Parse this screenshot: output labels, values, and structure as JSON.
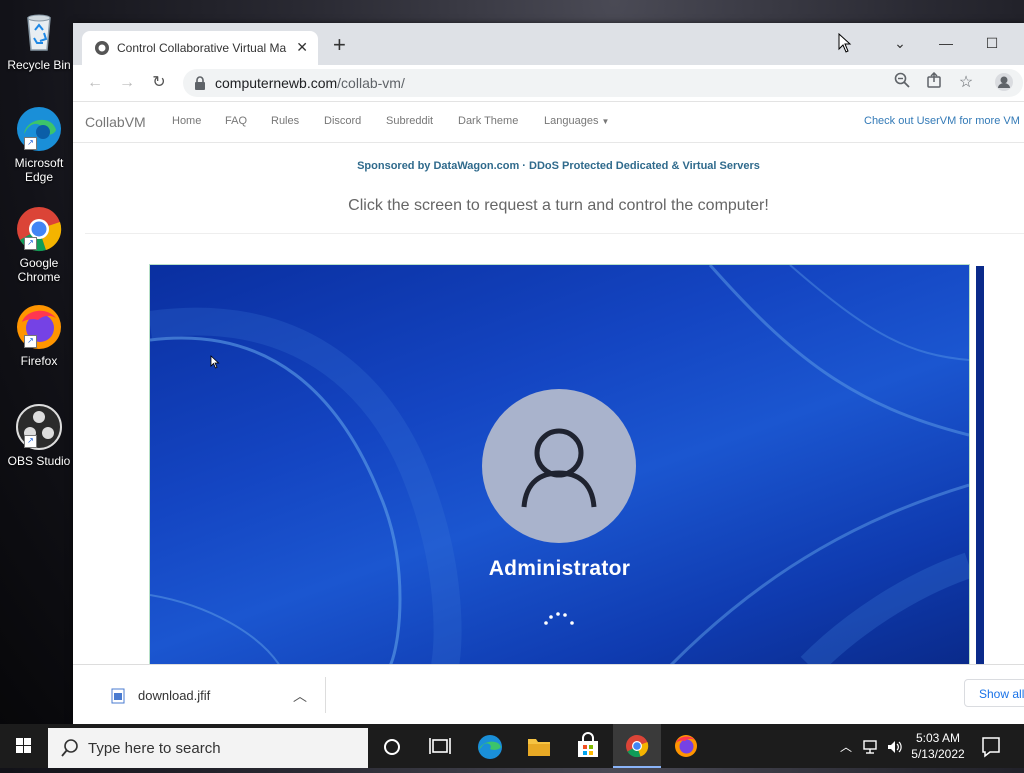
{
  "desktop": {
    "icons": [
      {
        "label": "Recycle Bin",
        "icon": "recycle-bin-icon"
      },
      {
        "label": "Microsoft Edge",
        "icon": "edge-icon"
      },
      {
        "label": "Google Chrome",
        "icon": "chrome-icon"
      },
      {
        "label": "Firefox",
        "icon": "firefox-icon"
      },
      {
        "label": "OBS Studio",
        "icon": "obs-icon"
      }
    ]
  },
  "browser": {
    "tab_title": "Control Collaborative Virtual Ma",
    "url_host": "computernewb.com",
    "url_path": "/collab-vm/"
  },
  "page": {
    "brand": "CollabVM",
    "nav": [
      "Home",
      "FAQ",
      "Rules",
      "Discord",
      "Subreddit",
      "Dark Theme",
      "Languages"
    ],
    "right_link": "Check out UserVM for more VM",
    "sponsor": "Sponsored by DataWagon.com · DDoS Protected Dedicated & Virtual Servers",
    "instruction": "Click the screen to request a turn and control the computer!",
    "vm": {
      "username": "Administrator"
    }
  },
  "downloads": {
    "file": "download.jfif",
    "show_all": "Show all"
  },
  "taskbar": {
    "search_placeholder": "Type here to search",
    "time": "5:03 AM",
    "date": "5/13/2022"
  },
  "colors": {
    "link": "#337ab7",
    "sponsor": "#2f6a8c",
    "vm_bg": "#1445c2",
    "taskbar": "#1c1c1c"
  }
}
